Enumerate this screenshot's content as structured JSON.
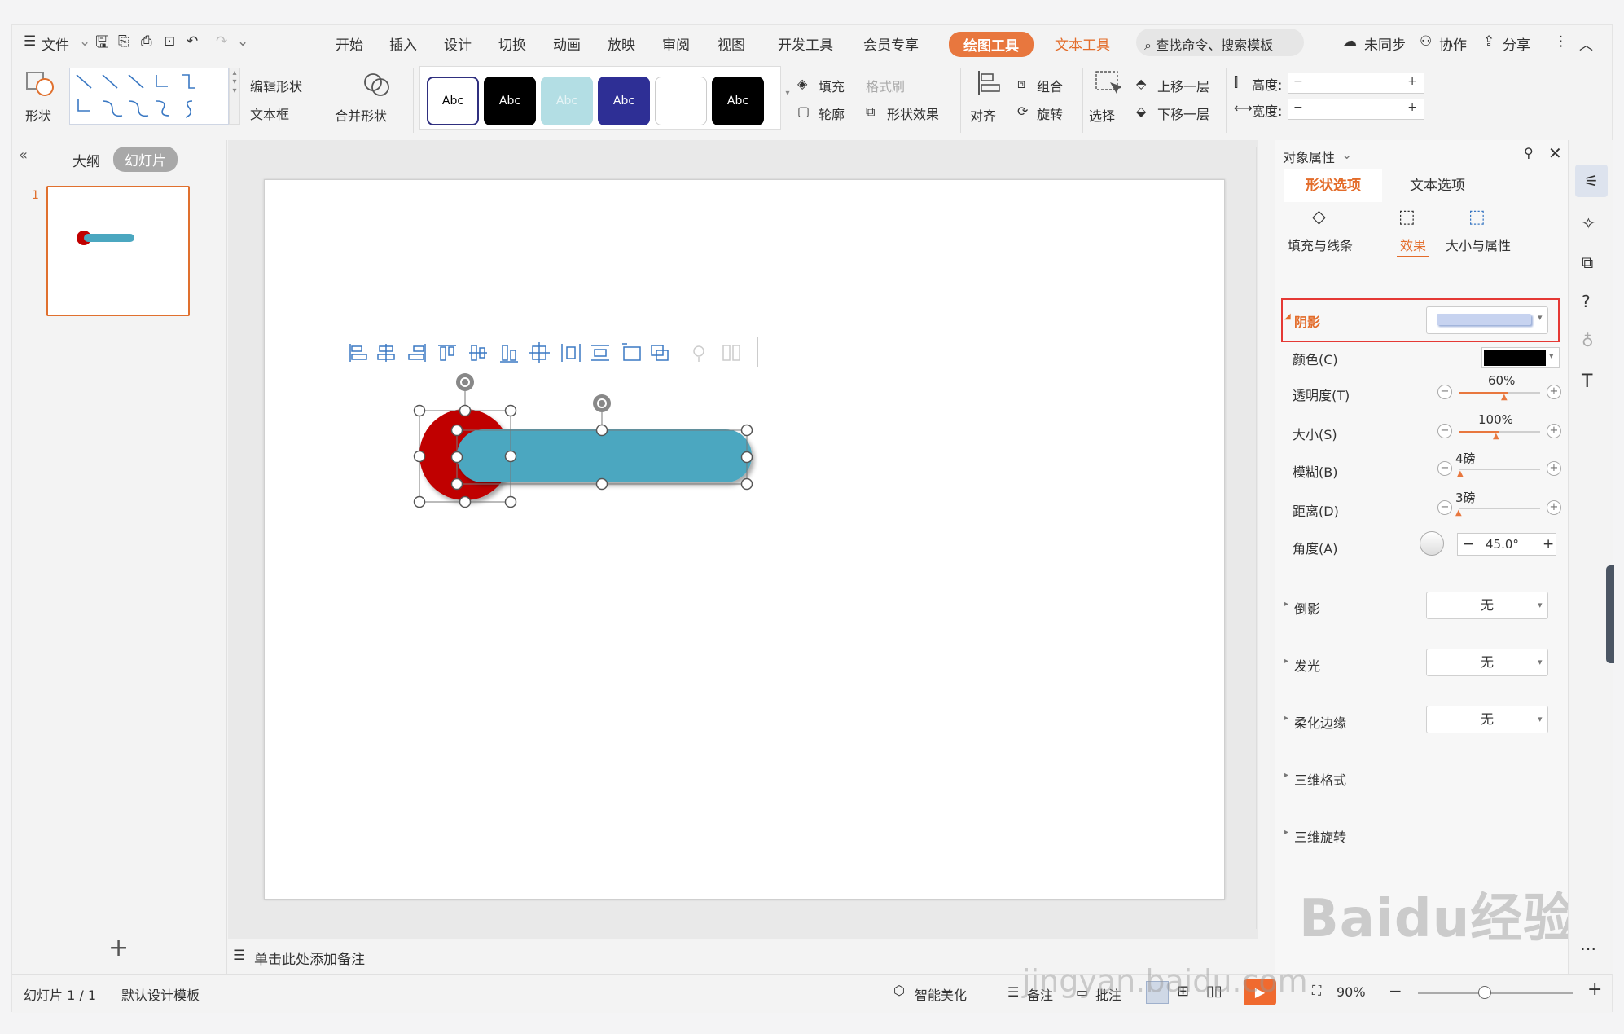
{
  "menu": {
    "file": "文件",
    "tabs": [
      "开始",
      "插入",
      "设计",
      "切换",
      "动画",
      "放映",
      "审阅",
      "视图",
      "开发工具",
      "会员专享"
    ],
    "drawing_tools": "绘图工具",
    "text_tools": "文本工具",
    "search_placeholder": "查找命令、搜索模板",
    "unsynced": "未同步",
    "collaborate": "协作",
    "share": "分享"
  },
  "ribbon": {
    "shape": "形状",
    "edit_shape": "编辑形状",
    "textbox": "文本框",
    "merge_shapes": "合并形状",
    "style_label": "Abc",
    "fill": "填充",
    "format_painter": "格式刷",
    "outline": "轮廓",
    "shape_effects": "形状效果",
    "align": "对齐",
    "group": "组合",
    "rotate": "旋转",
    "select": "选择",
    "bring_forward": "上移一层",
    "send_backward": "下移一层",
    "height": "高度:",
    "width": "宽度:"
  },
  "left": {
    "outline_tab": "大纲",
    "slides_tab": "幻灯片",
    "slide_number": "1"
  },
  "notes_placeholder": "单击此处添加备注",
  "panel": {
    "title": "对象属性",
    "tab_shape": "形状选项",
    "tab_text": "文本选项",
    "sub_fill": "填充与线条",
    "sub_effect": "效果",
    "sub_size": "大小与属性",
    "shadow": "阴影",
    "color": "颜色(C)",
    "transparency": "透明度(T)",
    "transparency_value": "60%",
    "size": "大小(S)",
    "size_value": "100%",
    "blur": "模糊(B)",
    "blur_value": "4磅",
    "distance": "距离(D)",
    "distance_value": "3磅",
    "angle": "角度(A)",
    "angle_value": "45.0°",
    "reflection": "倒影",
    "glow": "发光",
    "soft_edges": "柔化边缘",
    "none": "无",
    "threed_format": "三维格式",
    "threed_rotation": "三维旋转"
  },
  "status": {
    "slide_count": "幻灯片 1 / 1",
    "template": "默认设计模板",
    "smart_beautify": "智能美化",
    "notes": "备注",
    "comments": "批注",
    "zoom": "90%"
  },
  "watermark": {
    "brand": "Baidu经验",
    "url": "jingyan.baidu.com"
  },
  "colors": {
    "accent": "#e8773e",
    "shape_red": "#c00000",
    "shape_teal": "#4ba7c0",
    "highlight": "#e53935"
  }
}
